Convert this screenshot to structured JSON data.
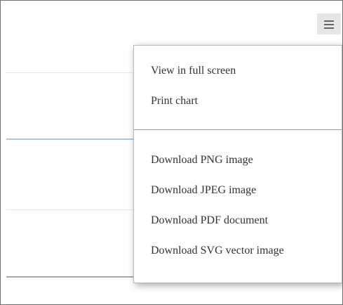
{
  "chart_menu": {
    "items": [
      "View in full screen",
      "Print chart",
      "Download PNG image",
      "Download JPEG image",
      "Download PDF document",
      "Download SVG vector image"
    ]
  },
  "icons": {
    "menu_button": "hamburger-icon"
  },
  "colors": {
    "series_line": "#a7c7ef",
    "menu_button_background": "#e6e6e6",
    "menu_text": "#333333"
  }
}
